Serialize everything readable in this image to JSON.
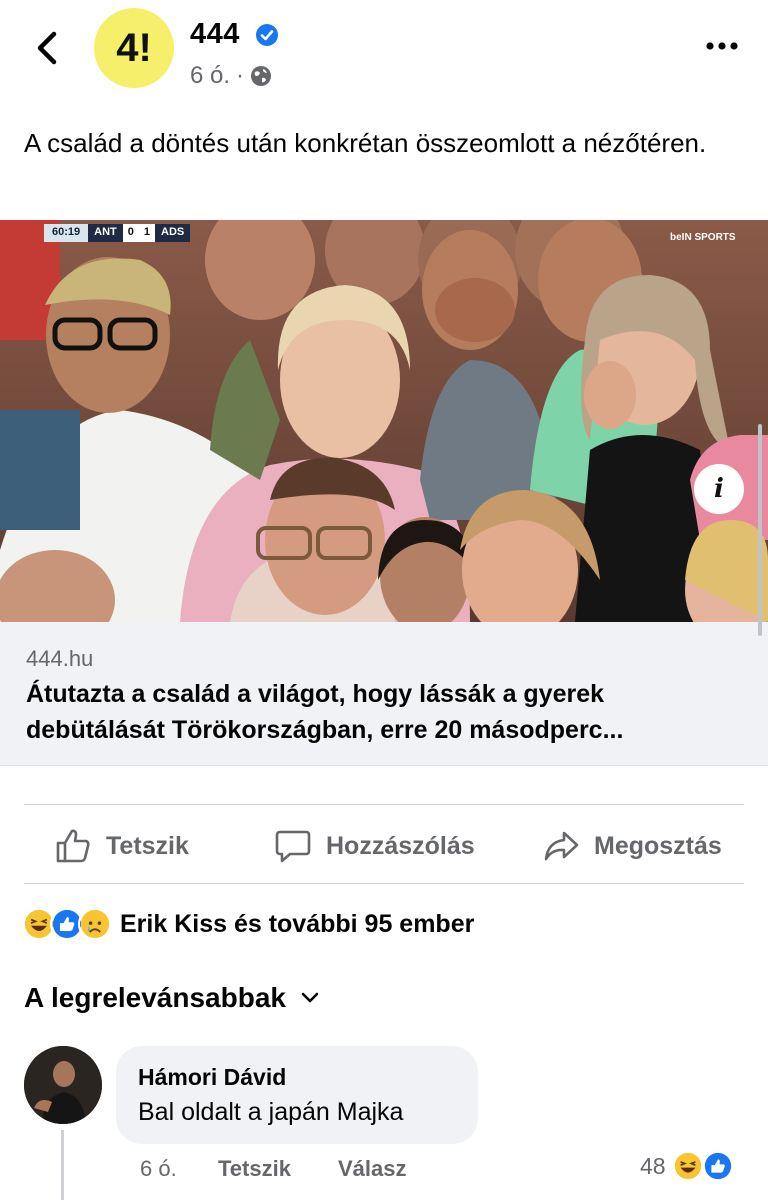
{
  "header": {
    "page_name": "444",
    "logo_text": "4!",
    "time": "6 ó.",
    "separator": "·"
  },
  "post": {
    "text": "A család a döntés után konkrétan összeomlott a nézőtéren."
  },
  "photo": {
    "scoreboard": {
      "time": "60:19",
      "home": "ANT",
      "home_score": "0",
      "away_score": "1",
      "away": "ADS"
    },
    "broadcaster": "beIN SPORTS",
    "info_label": "i"
  },
  "link": {
    "domain": "444.hu",
    "title": "Átutazta a család a világot, hogy lássák a gyerek debütálását Törökországban, erre 20 másodperc..."
  },
  "actions": {
    "like": "Tetszik",
    "comment": "Hozzászólás",
    "share": "Megosztás"
  },
  "reactions": {
    "summary": "Erik Kiss és további 95 ember",
    "icons": [
      "haha-icon",
      "like-icon",
      "sad-icon"
    ]
  },
  "sort": {
    "label": "A legrelevánsabbak"
  },
  "comment": {
    "author": "Hámori Dávid",
    "text": "Bal oldalt a japán Majka",
    "time": "6 ó.",
    "like": "Tetszik",
    "reply": "Válasz",
    "reaction_count": "48"
  },
  "colors": {
    "brand_blue": "#1877f2",
    "logo_yellow": "#f6ef6a",
    "muted": "#65676b"
  }
}
